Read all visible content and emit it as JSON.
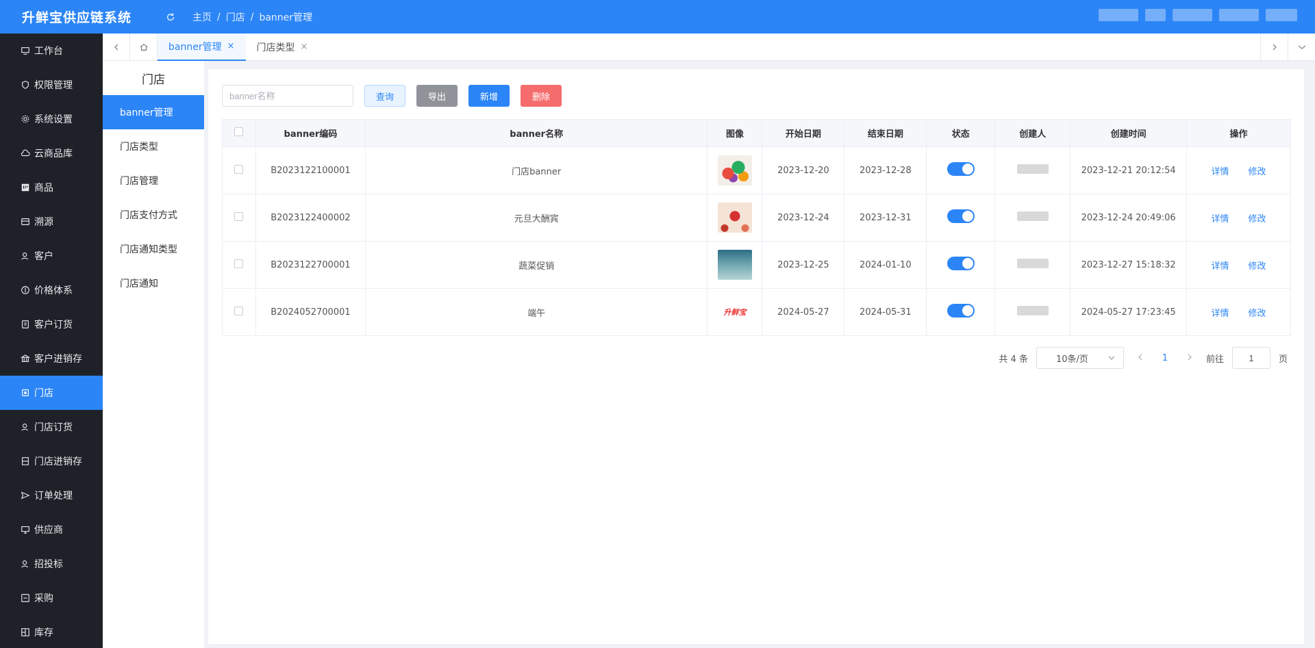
{
  "header": {
    "brand": "升鲜宝供应链系统",
    "breadcrumb": [
      "主页",
      "门店",
      "banner管理"
    ],
    "breadcrumb_sep": "/"
  },
  "sidebar": {
    "items": [
      {
        "label": "工作台",
        "icon": "monitor-icon"
      },
      {
        "label": "权限管理",
        "icon": "shield-icon"
      },
      {
        "label": "系统设置",
        "icon": "gear-icon"
      },
      {
        "label": "云商品库",
        "icon": "cloud-icon"
      },
      {
        "label": "商品",
        "icon": "goods-icon"
      },
      {
        "label": "溯源",
        "icon": "trace-icon"
      },
      {
        "label": "客户",
        "icon": "customer-icon"
      },
      {
        "label": "价格体系",
        "icon": "price-icon"
      },
      {
        "label": "客户订货",
        "icon": "order-icon"
      },
      {
        "label": "客户进销存",
        "icon": "bank-icon"
      },
      {
        "label": "门店",
        "icon": "store-icon",
        "active": true
      },
      {
        "label": "门店订货",
        "icon": "store-order-icon"
      },
      {
        "label": "门店进销存",
        "icon": "store-stock-icon"
      },
      {
        "label": "订单处理",
        "icon": "send-icon"
      },
      {
        "label": "供应商",
        "icon": "supplier-icon"
      },
      {
        "label": "招投标",
        "icon": "bid-icon"
      },
      {
        "label": "采购",
        "icon": "purchase-icon"
      },
      {
        "label": "库存",
        "icon": "inventory-icon"
      }
    ]
  },
  "tabs": {
    "items": [
      {
        "label": "banner管理",
        "active": true
      },
      {
        "label": "门店类型",
        "active": false
      }
    ],
    "close": "×"
  },
  "submenu": {
    "title": "门店",
    "items": [
      {
        "label": "banner管理",
        "active": true
      },
      {
        "label": "门店类型"
      },
      {
        "label": "门店管理"
      },
      {
        "label": "门店支付方式"
      },
      {
        "label": "门店通知类型"
      },
      {
        "label": "门店通知"
      }
    ]
  },
  "toolbar": {
    "search_placeholder": "banner名称",
    "query": "查询",
    "export": "导出",
    "add": "新增",
    "delete": "删除"
  },
  "table": {
    "headers": [
      "banner编码",
      "banner名称",
      "图像",
      "开始日期",
      "结束日期",
      "状态",
      "创建人",
      "创建时间",
      "操作"
    ],
    "rows": [
      {
        "code": "B2023122100001",
        "name": "门店banner",
        "image": "vegetables",
        "start": "2023-12-20",
        "end": "2023-12-28",
        "status": true,
        "created": "2023-12-21 20:12:54"
      },
      {
        "code": "B2023122400002",
        "name": "元旦大酬宾",
        "image": "new-year",
        "start": "2023-12-24",
        "end": "2023-12-31",
        "status": true,
        "created": "2023-12-24 20:49:06"
      },
      {
        "code": "B2023122700001",
        "name": "蔬菜促销",
        "image": "sea",
        "start": "2023-12-25",
        "end": "2024-01-10",
        "status": true,
        "created": "2023-12-27 15:18:32"
      },
      {
        "code": "B2024052700001",
        "name": "端午",
        "image": "logo",
        "image_text": "升鲜宝",
        "start": "2024-05-27",
        "end": "2024-05-31",
        "status": true,
        "created": "2024-05-27 17:23:45"
      }
    ],
    "actions": {
      "detail": "详情",
      "edit": "修改"
    }
  },
  "pagination": {
    "total": "共 4 条",
    "page_size": "10条/页",
    "current_page": "1",
    "goto_label": "前往",
    "goto_value": "1",
    "page_suffix": "页"
  },
  "colors": {
    "accent": "#2b85f6",
    "sidebar_bg": "#1e2228",
    "danger": "#f56c6c",
    "muted": "#909399"
  }
}
